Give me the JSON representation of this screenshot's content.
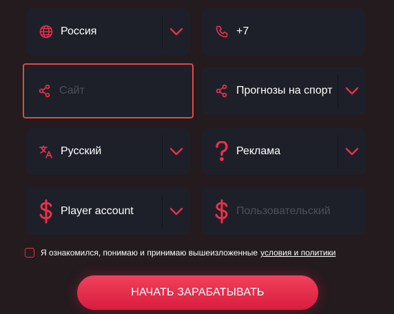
{
  "form": {
    "country": {
      "value": "Россия",
      "icon": "globe-icon"
    },
    "phone": {
      "value": "+7",
      "icon": "phone-icon"
    },
    "website": {
      "placeholder": "Сайт",
      "icon": "share-icon"
    },
    "traffic_type": {
      "value": "Прогнозы на спорт",
      "icon": "share-icon"
    },
    "language": {
      "value": "Русский",
      "icon": "translate-icon"
    },
    "source": {
      "value": "Реклама",
      "icon": "question-icon"
    },
    "account_type": {
      "value": "Player account",
      "icon": "dollar-icon"
    },
    "user_account": {
      "placeholder": "Пользовательский",
      "icon": "dollar-icon"
    }
  },
  "agreement": {
    "text": "Я ознакомился, понимаю и принимаю вышеизложенные",
    "link": "условия и политики"
  },
  "cta_label": "НАЧАТЬ ЗАРАБАТЫВАТЬ",
  "colors": {
    "background": "#241b1f",
    "field": "#1e2029",
    "accent": "#e8304c",
    "focus_border": "#e04a45"
  }
}
